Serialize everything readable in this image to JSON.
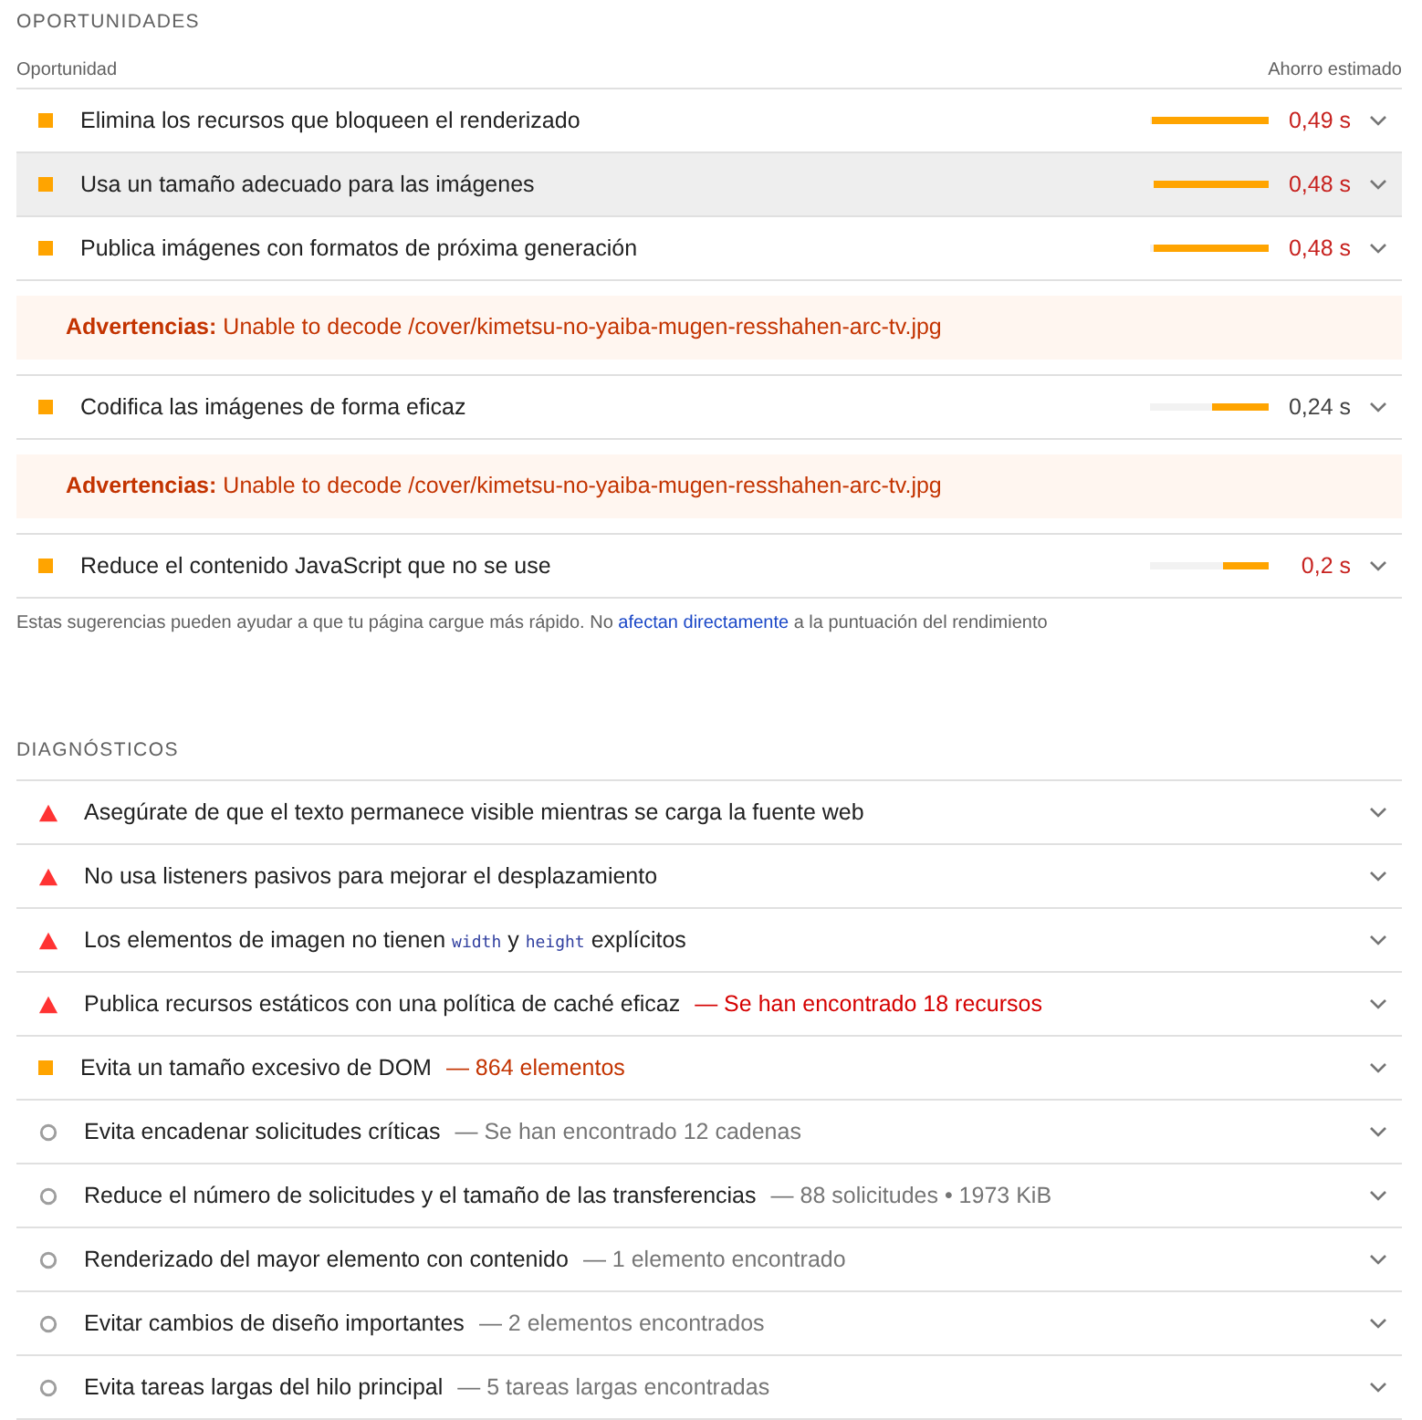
{
  "opportunities": {
    "heading": "OPORTUNIDADES",
    "column_1": "Oportunidad",
    "column_2": "Ahorro estimado",
    "items": [
      {
        "kind": "audit",
        "title": "Elimina los recursos que bloqueen el renderizado",
        "level": 0.98,
        "savings": "0,49 s",
        "failing": true,
        "highlighted": false
      },
      {
        "kind": "audit",
        "title": "Usa un tamaño adecuado para las imágenes",
        "level": 0.97,
        "savings": "0,48 s",
        "failing": true,
        "highlighted": true
      },
      {
        "kind": "audit",
        "title": "Publica imágenes con formatos de próxima generación",
        "level": 0.97,
        "savings": "0,48 s",
        "failing": true,
        "highlighted": false
      },
      {
        "kind": "warning",
        "label": "Advertencias:",
        "text": "Unable to decode /cover/kimetsu-no-yaiba-mugen-resshahen-arc-tv.jpg"
      },
      {
        "kind": "audit",
        "title": "Codifica las imágenes de forma eficaz",
        "level": 0.48,
        "savings": "0,24 s",
        "failing": false,
        "highlighted": false
      },
      {
        "kind": "warning",
        "label": "Advertencias:",
        "text": "Unable to decode /cover/kimetsu-no-yaiba-mugen-resshahen-arc-tv.jpg"
      },
      {
        "kind": "audit",
        "title": "Reduce el contenido JavaScript que no se use",
        "level": 0.39,
        "savings": "0,2 s",
        "failing": true,
        "highlighted": false
      }
    ],
    "footnote": {
      "before": "Estas sugerencias pueden ayudar a que tu página cargue más rápido. No",
      "link": "afectan directamente",
      "after": "a la puntuación del rendimiento"
    }
  },
  "diagnostics": {
    "heading": "DIAGNÓSTICOS",
    "items": [
      {
        "kind": "fail",
        "title": [
          {
            "kind": "text",
            "text": "Asegúrate de que el texto permanece visible mientras se carga la fuente web"
          }
        ]
      },
      {
        "kind": "fail",
        "title": [
          {
            "kind": "text",
            "text": "No usa listeners pasivos para mejorar el desplazamiento"
          }
        ]
      },
      {
        "kind": "fail",
        "title": [
          {
            "kind": "text",
            "text": "Los elementos de imagen no tienen "
          },
          {
            "kind": "code",
            "text": "width"
          },
          {
            "kind": "text",
            "text": " y "
          },
          {
            "kind": "code",
            "text": "height"
          },
          {
            "kind": "text",
            "text": " explícitos"
          }
        ]
      },
      {
        "kind": "fail",
        "title": [
          {
            "kind": "text",
            "text": "Publica recursos estáticos con una política de caché eficaz"
          }
        ],
        "detail": "— Se han encontrado 18 recursos"
      },
      {
        "kind": "average",
        "title": [
          {
            "kind": "text",
            "text": "Evita un tamaño excesivo de DOM"
          }
        ],
        "detail": "— 864 elementos"
      },
      {
        "kind": "info",
        "title": [
          {
            "kind": "text",
            "text": "Evita encadenar solicitudes críticas"
          }
        ],
        "detail": "— Se han encontrado 12 cadenas"
      },
      {
        "kind": "info",
        "title": [
          {
            "kind": "text",
            "text": "Reduce el número de solicitudes y el tamaño de las transferencias"
          }
        ],
        "detail": "— 88 solicitudes • 1973 KiB"
      },
      {
        "kind": "info",
        "title": [
          {
            "kind": "text",
            "text": "Renderizado del mayor elemento con contenido"
          }
        ],
        "detail": "— 1 elemento encontrado"
      },
      {
        "kind": "info",
        "title": [
          {
            "kind": "text",
            "text": "Evitar cambios de diseño importantes"
          }
        ],
        "detail": "— 2 elementos encontrados"
      },
      {
        "kind": "info",
        "title": [
          {
            "kind": "text",
            "text": "Evita tareas largas del hilo principal"
          }
        ],
        "detail": "— 5 tareas largas encontradas"
      }
    ]
  }
}
